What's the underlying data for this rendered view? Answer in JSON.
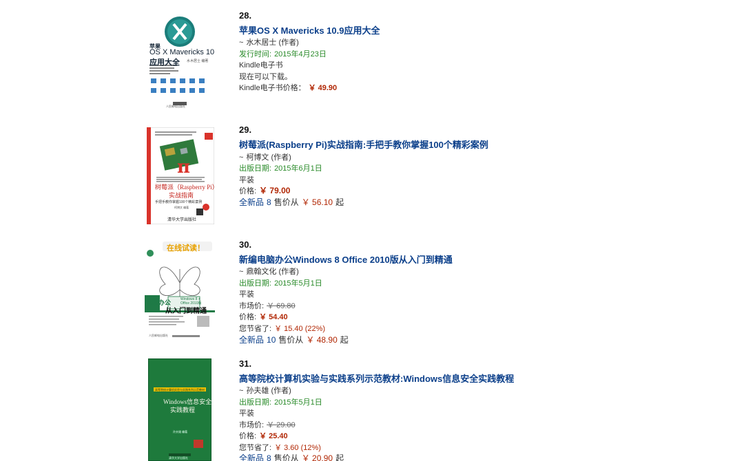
{
  "items": [
    {
      "rank": "28.",
      "title": "苹果OS X Mavericks 10.9应用大全",
      "author_prefix": "~",
      "author": "水木居士 (作者)",
      "date_label": "发行时间:",
      "date": "2015年4月23日",
      "format": "Kindle电子书",
      "availability": "现在可以下载。",
      "price_label": "Kindle电子书价格：",
      "price": "￥ 49.90",
      "cover": {
        "top_text": "苹果",
        "title_line": "OS X Mavericks 10.9",
        "subtitle": "应用大全",
        "small": "水木居士 编著",
        "publisher": "人民邮电出版社"
      }
    },
    {
      "rank": "29.",
      "title": "树莓派(Raspberry Pi)实战指南:手把手教你掌握100个精彩案例",
      "author_prefix": "~",
      "author": "柯博文 (作者)",
      "date_label": "出版日期:",
      "date": "2015年6月1日",
      "format": "平装",
      "price_label": "价格:",
      "price": "￥ 79.00",
      "offers_prefix": "全新品",
      "offers_count": "8",
      "offers_text": "售价从",
      "offers_price": "￥ 56.10",
      "offers_suffix": "起",
      "cover": {
        "title_line": "树莓派（Raspberry Pi）",
        "subtitle": "实战指南",
        "small": "手把手教你掌握100个精彩案例",
        "author": "柯博文 编著",
        "publisher": "清华大学出版社"
      }
    },
    {
      "rank": "30.",
      "title": "新编电脑办公Windows 8 Office 2010版从入门到精通",
      "author_prefix": "~",
      "author": "鼎翰文化 (作者)",
      "date_label": "出版日期:",
      "date": "2015年5月1日",
      "format": "平装",
      "list_price_label": "市场价:",
      "list_price": "￥ 69.80",
      "price_label": "价格:",
      "price": "￥ 54.40",
      "savings_label": "您节省了:",
      "savings": "￥ 15.40 (22%)",
      "offers_prefix": "全新品",
      "offers_count": "10",
      "offers_text": "售价从",
      "offers_price": "￥ 48.90",
      "offers_suffix": "起",
      "cover": {
        "banner": "在线试读！",
        "title_line": "电脑办公",
        "badge": "Windows 8 + Office 2010版",
        "subtitle": "从入门到精通",
        "publisher": "人民邮电出版社"
      }
    },
    {
      "rank": "31.",
      "title": "高等院校计算机实验与实践系列示范教材:Windows信息安全实践教程",
      "author_prefix": "~",
      "author": "孙夫雄 (作者)",
      "date_label": "出版日期:",
      "date": "2015年5月1日",
      "format": "平装",
      "list_price_label": "市场价:",
      "list_price": "￥ 29.00",
      "price_label": "价格:",
      "price": "￥ 25.40",
      "savings_label": "您节省了:",
      "savings": "￥ 3.60 (12%)",
      "offers_prefix": "全新品",
      "offers_count": "8",
      "offers_text": "售价从",
      "offers_price": "￥ 20.90",
      "offers_suffix": "起",
      "cover": {
        "series": "高等院校计算机实验与实践系列示范教材",
        "title_line": "Windows信息安全",
        "subtitle": "实践教程",
        "author": "孙夫雄 编著",
        "publisher": "清华大学出版社"
      }
    }
  ],
  "colors": {
    "title_link": "#0b3f8a",
    "date_green": "#2a8b2a",
    "price_red": "#b12704",
    "cover3_green": "#1f7a46",
    "cover4_green": "#1e7a3c"
  }
}
